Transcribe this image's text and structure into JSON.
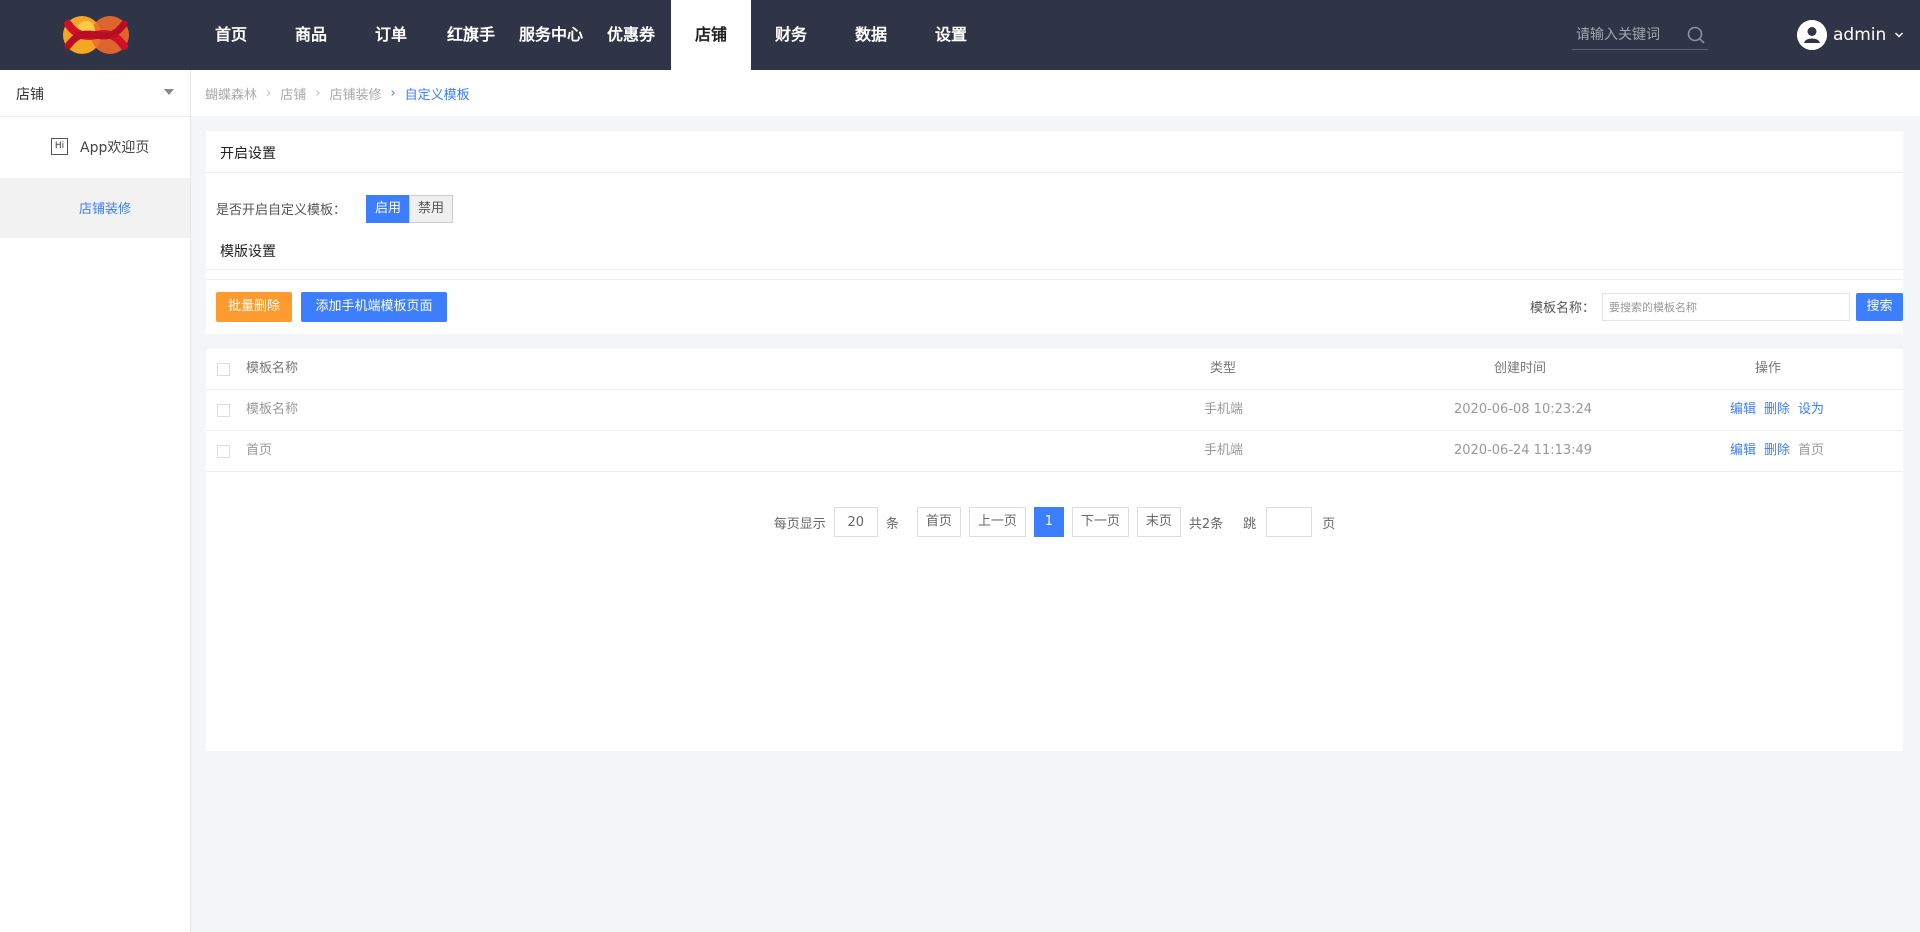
{
  "header": {
    "nav": [
      {
        "label": "首页"
      },
      {
        "label": "商品"
      },
      {
        "label": "订单"
      },
      {
        "label": "红旗手"
      },
      {
        "label": "服务中心"
      },
      {
        "label": "优惠券"
      },
      {
        "label": "店铺",
        "active": true
      },
      {
        "label": "财务"
      },
      {
        "label": "数据"
      },
      {
        "label": "设置"
      }
    ],
    "search_placeholder": "请输入关键词",
    "user_name": "admin"
  },
  "sidebar": {
    "select_label": "店铺",
    "app_icon_text": "Hi",
    "app_label": "App欢迎页",
    "decor_label": "店铺装修"
  },
  "breadcrumb": [
    "蝴蝶森林",
    "店铺",
    "店铺装修",
    "自定义模板"
  ],
  "open_settings": {
    "title": "开启设置",
    "enable_label": "是否开启自定义模板：",
    "enable_on": "启用",
    "enable_off": "禁用"
  },
  "template_settings": {
    "title": "模版设置",
    "batch_delete": "批量删除",
    "add_mobile": "添加手机端模板页面",
    "search_label": "模板名称：",
    "search_placeholder": "要搜索的模板名称",
    "search_button": "搜索"
  },
  "table": {
    "headers": {
      "name": "模板名称",
      "type": "类型",
      "created": "创建时间",
      "ops": "操作"
    },
    "rows": [
      {
        "name": "模板名称",
        "type": "手机端",
        "created": "2020-06-08 10:23:24",
        "edit": "编辑",
        "delete": "删除",
        "extra": "设为",
        "extra_link": true
      },
      {
        "name": "首页",
        "type": "手机端",
        "created": "2020-06-24 11:13:49",
        "edit": "编辑",
        "delete": "删除",
        "extra": "首页",
        "extra_link": false
      }
    ]
  },
  "pagination": {
    "per_page_label": "每页显示",
    "per_page_value": "20",
    "unit": "条",
    "first": "首页",
    "prev": "上一页",
    "current": "1",
    "next": "下一页",
    "last": "末页",
    "total": "共2条",
    "jump_label": "跳",
    "page_unit": "页"
  },
  "colors": {
    "topbar": "#2f3546",
    "accent": "#3d7eff",
    "orange": "#ff9a2e"
  }
}
